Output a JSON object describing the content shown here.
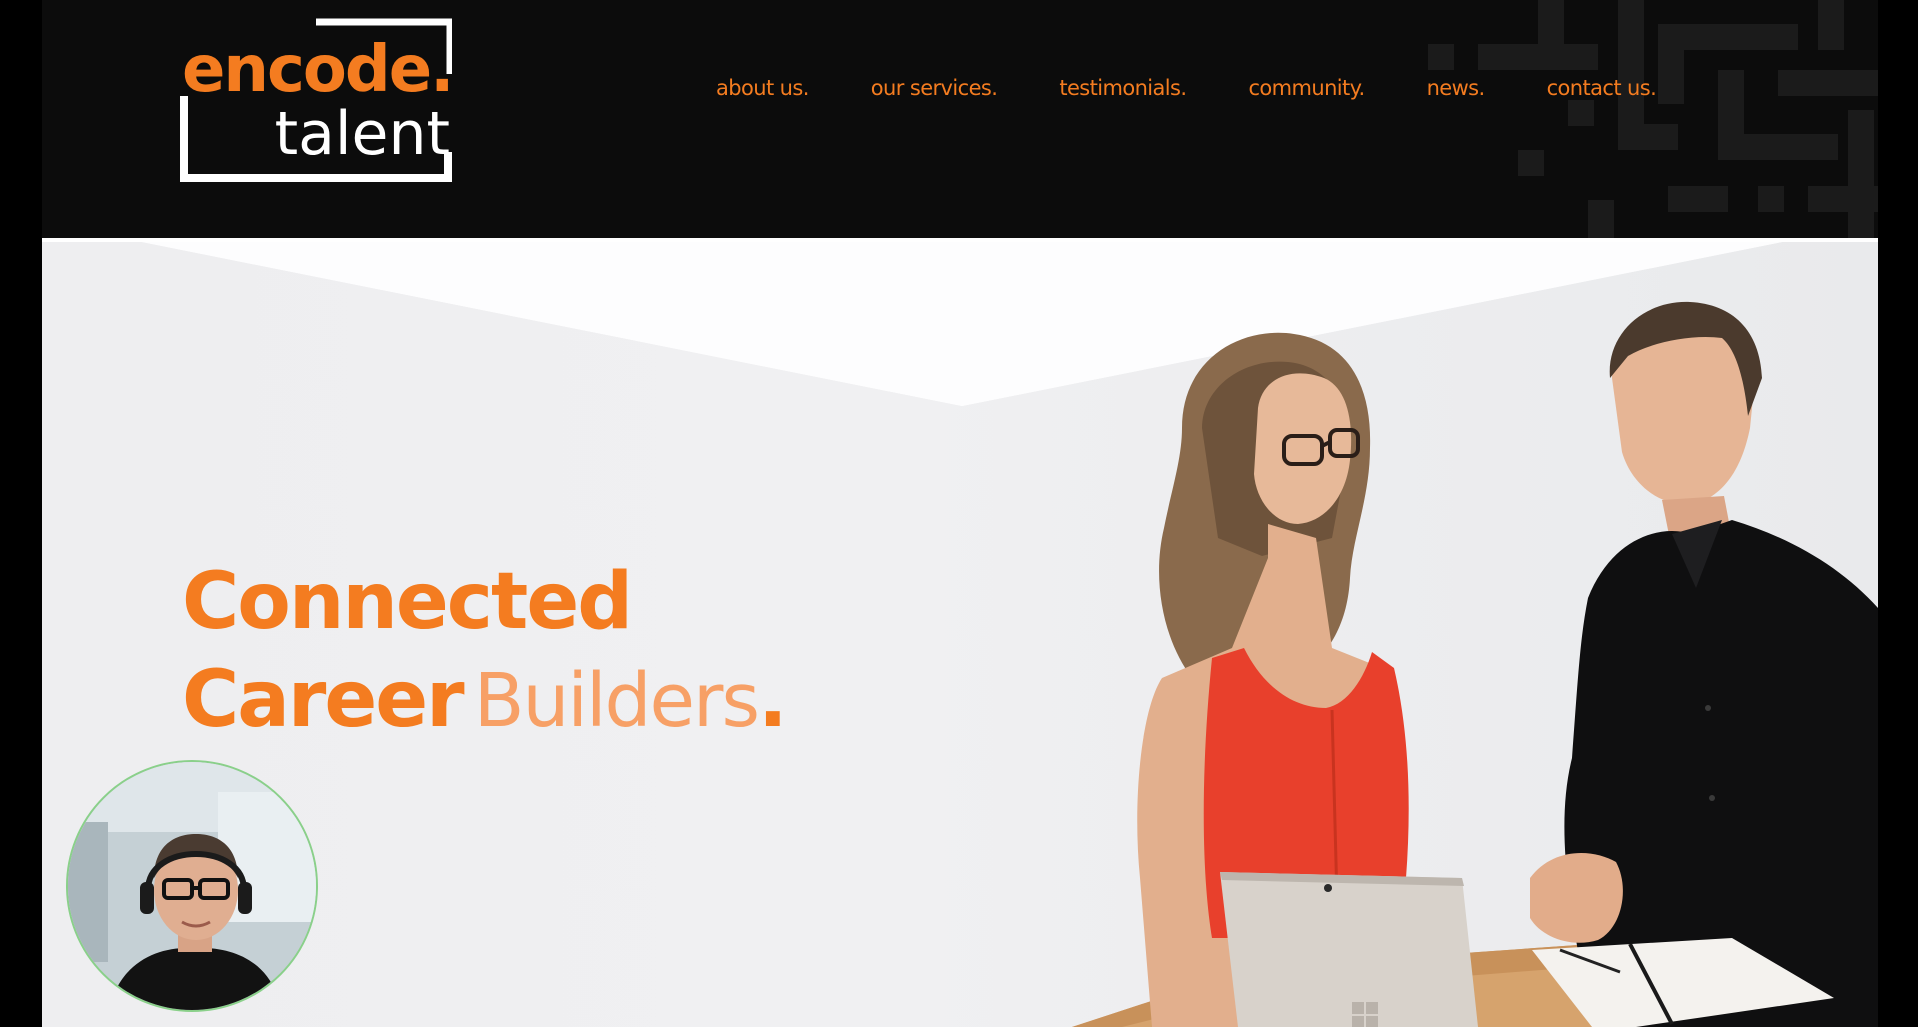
{
  "logo": {
    "word1": "encode",
    "word2": "talent",
    "dot": ".",
    "colors": {
      "orange": "#f47c20",
      "white": "#ffffff"
    }
  },
  "nav": {
    "items": [
      {
        "label": "about us."
      },
      {
        "label": "our services."
      },
      {
        "label": "testimonials."
      },
      {
        "label": "community."
      },
      {
        "label": "news."
      },
      {
        "label": "contact us."
      }
    ]
  },
  "hero": {
    "line1": "Connected",
    "line2_bold": "Career",
    "line2_light": "Builders",
    "line2_dot": "."
  },
  "theme": {
    "accent": "#f47c20",
    "header_bg": "#0c0c0c",
    "hero_bg": "#efeff1"
  },
  "icons": {
    "maze_pattern": "maze-pattern-icon",
    "laptop_logo": "windows-logo-icon"
  }
}
